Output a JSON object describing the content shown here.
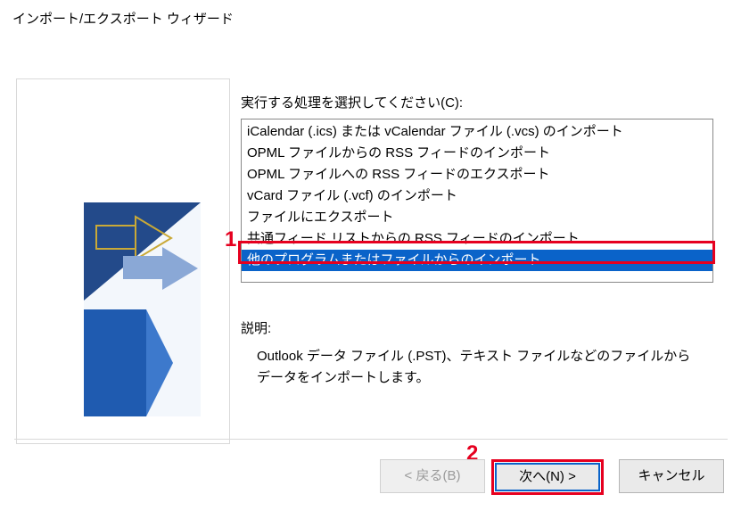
{
  "window": {
    "title": "インポート/エクスポート ウィザード"
  },
  "main": {
    "prompt": "実行する処理を選択してください(C):",
    "options": [
      "iCalendar (.ics) または vCalendar ファイル (.vcs) のインポート",
      "OPML ファイルからの RSS フィードのインポート",
      "OPML ファイルへの RSS フィードのエクスポート",
      "vCard ファイル (.vcf) のインポート",
      "ファイルにエクスポート",
      "共通フィード リストからの RSS フィードのインポート",
      "他のプログラムまたはファイルからのインポート"
    ],
    "description_label": "説明:",
    "description_text": "Outlook データ ファイル (.PST)、テキスト ファイルなどのファイルからデータをインポートします。"
  },
  "buttons": {
    "back": "< 戻る(B)",
    "next": "次へ(N) >",
    "cancel": "キャンセル"
  },
  "annotations": {
    "a1": "1",
    "a2": "2"
  }
}
